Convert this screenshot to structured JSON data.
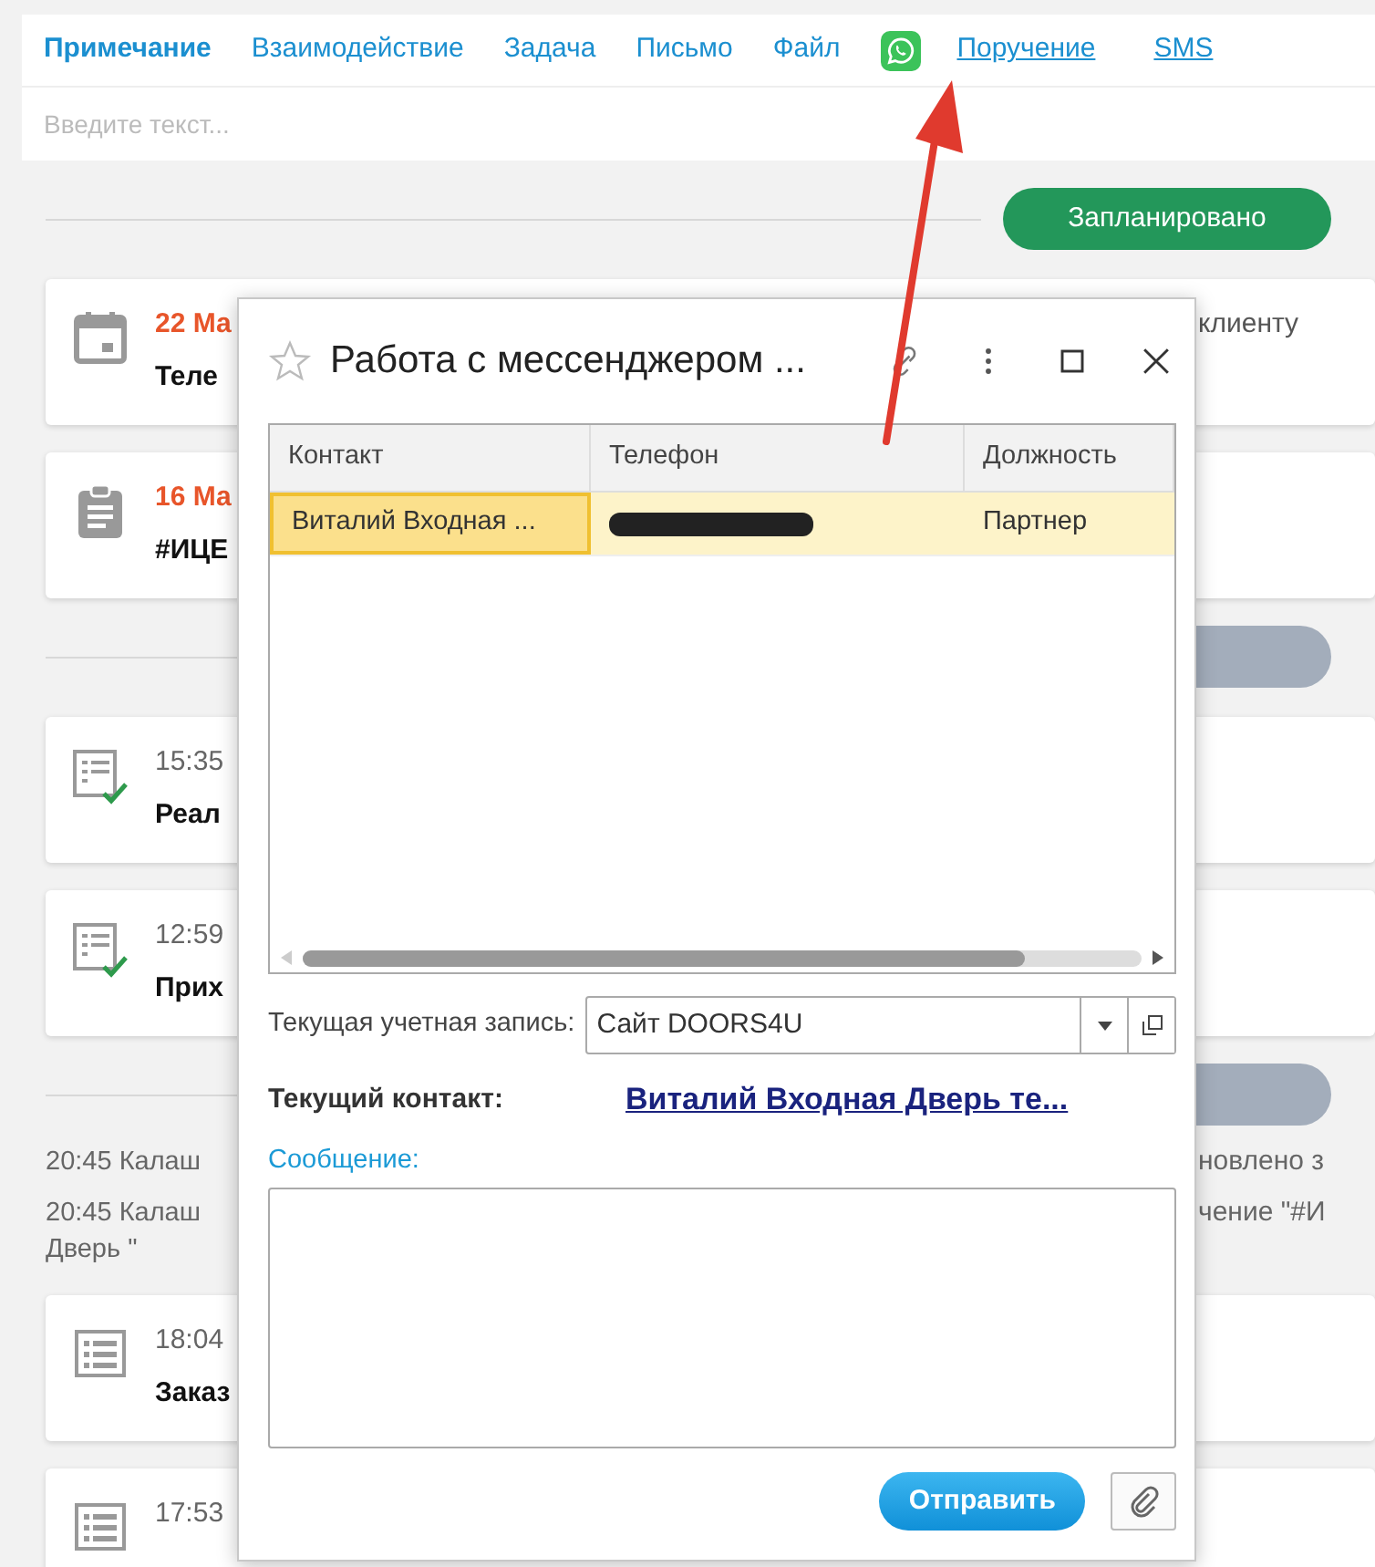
{
  "tabs": [
    {
      "kind": "tab",
      "label": "Примечание",
      "selected": true
    },
    {
      "kind": "tab",
      "label": "Взаимодействие",
      "selected": false
    },
    {
      "kind": "tab",
      "label": "Задача",
      "selected": false
    },
    {
      "kind": "tab",
      "label": "Письмо",
      "selected": false
    },
    {
      "kind": "tab",
      "label": "Файл",
      "selected": false
    },
    {
      "kind": "icon",
      "selected": false
    },
    {
      "kind": "link",
      "label": "Поручение",
      "selected": false
    },
    {
      "kind": "link",
      "label": "SMS",
      "selected": false
    }
  ],
  "note_input": {
    "placeholder": "Введите текст..."
  },
  "timeline": [
    {
      "kind": "divider",
      "pill": "Запланировано",
      "color": "#23975a"
    },
    {
      "kind": "calendar",
      "date": "22 Ма",
      "right": "клиенту",
      "subtitle": "Теле"
    },
    {
      "kind": "clipboard",
      "date": "16 Ма",
      "subtitle": "#ИЦЕ"
    },
    {
      "kind": "divider",
      "color": "#a3adbb"
    },
    {
      "kind": "checklist",
      "time": "15:35",
      "subtitle": "Реал"
    },
    {
      "kind": "checklist",
      "time": "12:59",
      "subtitle": "Прих"
    },
    {
      "kind": "divider",
      "color": "#a3adbb"
    },
    {
      "kind": "log",
      "left": "20:45 Калаш",
      "right": "новлено з"
    },
    {
      "kind": "log",
      "left": "20:45 Калаш",
      "right": "чение \"#И",
      "continuation": "Дверь \""
    },
    {
      "kind": "list",
      "time": "18:04",
      "subtitle": "Заказ"
    },
    {
      "kind": "list",
      "time": "17:53"
    }
  ],
  "dialog": {
    "title": "Работа с мессенджером ...",
    "favorite": false,
    "table": {
      "columns": [
        "Контакт",
        "Телефон",
        "Должность"
      ],
      "rows": [
        {
          "contact": "Виталий Входная ...",
          "phone_redacted": true,
          "position": "Партнер",
          "selected": true
        }
      ]
    },
    "account_label": "Текущая учетная запись:",
    "account": "Сайт DOORS4U",
    "contact_label": "Текущий контакт:",
    "contact_link": "Виталий Входная Дверь  те...",
    "message_label": "Сообщение:",
    "send_button": "Отправить"
  }
}
